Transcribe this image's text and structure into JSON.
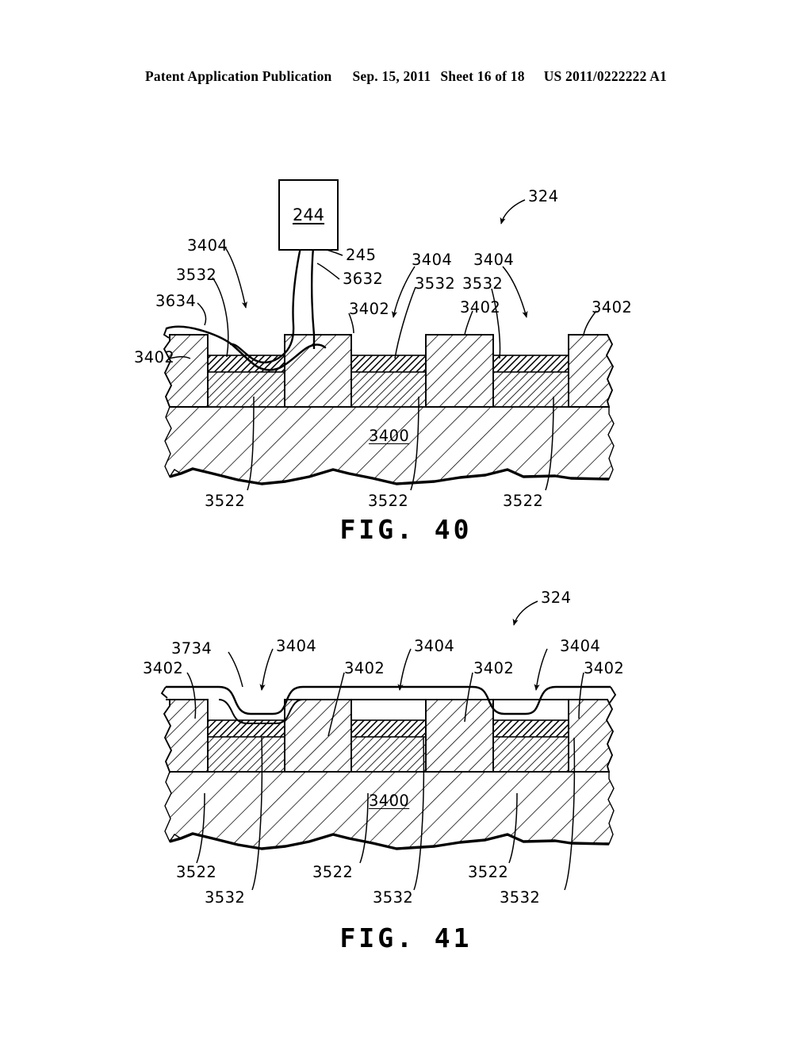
{
  "header": {
    "publication": "Patent Application Publication",
    "date": "Sep. 15, 2011",
    "sheet": "Sheet 16 of 18",
    "patent_number": "US 2011/0222222 A1"
  },
  "figures": [
    {
      "caption": "FIG. 40",
      "assembly_ref": "324",
      "substrate_ref": "3400",
      "tool_box": {
        "ref": "244",
        "nozzle_ref": "245",
        "stream_ref": "3632"
      },
      "labels": [
        {
          "text": "324"
        },
        {
          "text": "3404"
        },
        {
          "text": "3532"
        },
        {
          "text": "3634"
        },
        {
          "text": "3402"
        },
        {
          "text": "245"
        },
        {
          "text": "3632"
        },
        {
          "text": "3404"
        },
        {
          "text": "3532"
        },
        {
          "text": "3402"
        },
        {
          "text": "3404"
        },
        {
          "text": "3532"
        },
        {
          "text": "3402"
        },
        {
          "text": "3402"
        },
        {
          "text": "3400"
        },
        {
          "text": "3522"
        },
        {
          "text": "3522"
        },
        {
          "text": "3522"
        }
      ]
    },
    {
      "caption": "FIG. 41",
      "assembly_ref": "324",
      "substrate_ref": "3400",
      "conformal_layer_ref": "3734",
      "labels": [
        {
          "text": "324"
        },
        {
          "text": "3734"
        },
        {
          "text": "3402"
        },
        {
          "text": "3404"
        },
        {
          "text": "3402"
        },
        {
          "text": "3404"
        },
        {
          "text": "3402"
        },
        {
          "text": "3404"
        },
        {
          "text": "3402"
        },
        {
          "text": "3522"
        },
        {
          "text": "3522"
        },
        {
          "text": "3522"
        },
        {
          "text": "3532"
        },
        {
          "text": "3532"
        },
        {
          "text": "3532"
        },
        {
          "text": "3400"
        }
      ]
    }
  ],
  "fig40": {
    "l_3404_a": "3404",
    "l_3532_a": "3532",
    "l_3634": "3634",
    "l_3402_left": "3402",
    "l_244": "244",
    "l_245": "245",
    "l_3632": "3632",
    "l_3402_b": "3402",
    "l_3404_b": "3404",
    "l_3532_b": "3532",
    "l_3404_c": "3404",
    "l_3532_c": "3532",
    "l_3402_c": "3402",
    "l_3402_d": "3402",
    "l_324": "324",
    "l_3400": "3400",
    "l_3522_a": "3522",
    "l_3522_b": "3522",
    "l_3522_c": "3522",
    "caption": "FIG. 40"
  },
  "fig41": {
    "l_324": "324",
    "l_3734": "3734",
    "l_3402_a": "3402",
    "l_3404_a": "3404",
    "l_3402_b": "3402",
    "l_3404_b": "3404",
    "l_3402_c": "3402",
    "l_3404_c": "3404",
    "l_3402_d": "3402",
    "l_3400": "3400",
    "l_3522_a": "3522",
    "l_3522_b": "3522",
    "l_3522_c": "3522",
    "l_3532_a": "3532",
    "l_3532_b": "3532",
    "l_3532_c": "3532",
    "caption": "FIG. 41"
  },
  "colors": {
    "ink": "#000000",
    "paper": "#ffffff"
  }
}
